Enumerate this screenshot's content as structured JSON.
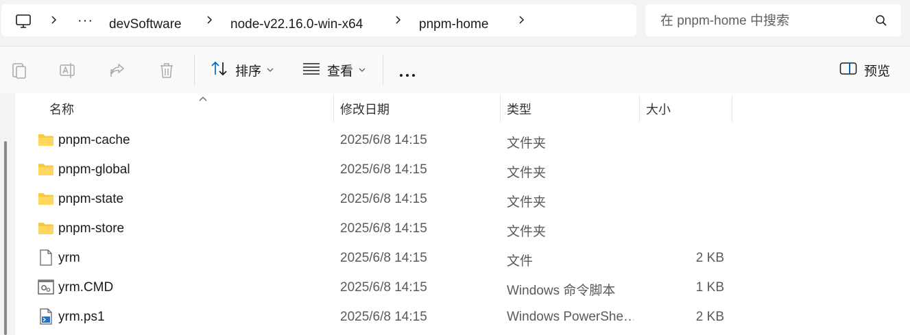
{
  "breadcrumb": {
    "root_icon": "monitor-icon",
    "overflow": "···",
    "items": [
      "devSoftware",
      "node-v22.16.0-win-x64",
      "pnpm-home"
    ]
  },
  "search": {
    "placeholder": "在 pnpm-home 中搜索",
    "value": ""
  },
  "toolbar": {
    "sort_label": "排序",
    "view_label": "查看",
    "preview_label": "预览",
    "icons": [
      "copy-icon",
      "rename-icon",
      "share-icon",
      "delete-icon",
      "sort-icon",
      "view-icon",
      "more-icon",
      "preview-pane-icon"
    ]
  },
  "columns": {
    "name": "名称",
    "date": "修改日期",
    "type": "类型",
    "size": "大小"
  },
  "files": [
    {
      "name": "pnpm-cache",
      "date": "2025/6/8 14:15",
      "type": "文件夹",
      "size": "",
      "icon": "folder-icon"
    },
    {
      "name": "pnpm-global",
      "date": "2025/6/8 14:15",
      "type": "文件夹",
      "size": "",
      "icon": "folder-icon"
    },
    {
      "name": "pnpm-state",
      "date": "2025/6/8 14:15",
      "type": "文件夹",
      "size": "",
      "icon": "folder-icon"
    },
    {
      "name": "pnpm-store",
      "date": "2025/6/8 14:15",
      "type": "文件夹",
      "size": "",
      "icon": "folder-icon"
    },
    {
      "name": "yrm",
      "date": "2025/6/8 14:15",
      "type": "文件",
      "size": "2 KB",
      "icon": "file-icon"
    },
    {
      "name": "yrm.CMD",
      "date": "2025/6/8 14:15",
      "type": "Windows 命令脚本",
      "size": "1 KB",
      "icon": "cmd-script-icon"
    },
    {
      "name": "yrm.ps1",
      "date": "2025/6/8 14:15",
      "type": "Windows PowerShe…",
      "size": "2 KB",
      "icon": "powershell-script-icon"
    }
  ],
  "colors": {
    "folder": "#f8c83d",
    "accent": "#0067c0",
    "disabled_icon": "#a8a8a8"
  }
}
